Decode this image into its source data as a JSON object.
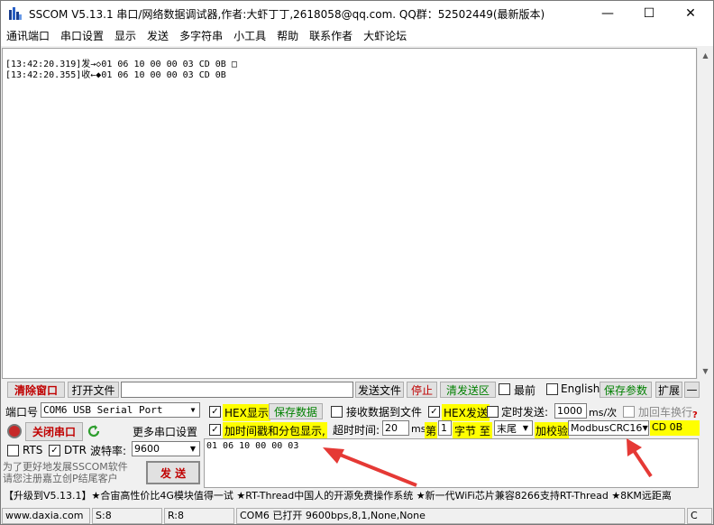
{
  "window": {
    "title": "SSCOM V5.13.1 串口/网络数据调试器,作者:大虾丁丁,2618058@qq.com. QQ群：52502449(最新版本)",
    "minimize_glyph": "—",
    "maximize_glyph": "☐",
    "close_glyph": "✕"
  },
  "menu": [
    "通讯端口",
    "串口设置",
    "显示",
    "发送",
    "多字符串",
    "小工具",
    "帮助",
    "联系作者",
    "大虾论坛"
  ],
  "receive": {
    "lines": [
      "[13:42:20.319]发→◇01 06 10 00 00 03 CD 0B □",
      "[13:42:20.355]收←◆01 06 10 00 00 03 CD 0B"
    ]
  },
  "toolbar": {
    "clear_window": "清除窗口",
    "open_file": "打开文件",
    "file_path": "",
    "send_file": "发送文件",
    "stop": "停止",
    "clear_send": "清发送区",
    "topmost": "最前",
    "english": "English",
    "save_params": "保存参数",
    "expand": "扩展",
    "collapse": "—"
  },
  "port": {
    "port_label": "端口号",
    "port_value": "COM6 USB Serial Port",
    "close_port": "关闭串口",
    "more_settings": "更多串口设置",
    "rts": "RTS",
    "dtr": "DTR",
    "baud_label": "波特率:",
    "baud_value": "9600",
    "promo": "为了更好地发展SSCOM软件\n请您注册嘉立创P结尾客户",
    "send_button": "发 送"
  },
  "options": {
    "hex_display": "HEX显示",
    "save_data": "保存数据",
    "recv_to_file": "接收数据到文件",
    "hex_send": "HEX发送",
    "timed_send": "定时发送:",
    "interval": "1000",
    "interval_unit": "ms/次",
    "add_crlf": "加回车换行",
    "timestamp": "加时间戳和分包显示,",
    "timeout_label": "超时时间:",
    "timeout_value": "20",
    "timeout_unit": "ms",
    "nth_label": "第",
    "nth_value": "1",
    "byte_to": "字节 至",
    "end_value": "末尾",
    "checksum_label": "加校验",
    "checksum_value": "ModbusCRC16",
    "crc_result": "CD 0B",
    "help_glyph": "?"
  },
  "send": {
    "content": "01 06 10 00 00 03"
  },
  "ticker": "【升级到V5.13.1】★合宙高性价比4G模块值得一试 ★RT-Thread中国人的开源免费操作系统 ★新一代WiFi芯片兼容8266支持RT-Thread ★8KM远距离",
  "statusbar": {
    "site": "www.daxia.com",
    "sent": "S:8",
    "received": "R:8",
    "port_state": "COM6 已打开  9600bps,8,1,None,None",
    "end": "C"
  },
  "colors": {
    "highlight": "#ffff00",
    "arrow": "#e53935",
    "stop": "#c00000",
    "green": "#008000"
  }
}
